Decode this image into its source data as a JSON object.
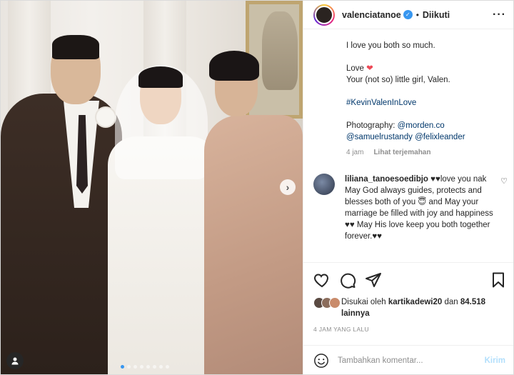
{
  "post": {
    "username": "valenciatanoe",
    "verified_icon": "verified-badge-icon",
    "separator": "•",
    "follow_status": "Diikuti",
    "more_icon": "more-options-icon"
  },
  "caption": {
    "line1": "I love you both so much.",
    "love_label": "Love",
    "love_emoji": "❤️",
    "line3": "Your (not so) little girl, Valen.",
    "hashtag": "#KevinValenInLove",
    "photo_label": "Photography:",
    "credit1": "@morden.co",
    "credit2": "@samuelrustandy",
    "credit3": "@felixleander",
    "time": "4 jam",
    "translate": "Lihat terjemahan"
  },
  "comment": {
    "username": "liliana_tanoesoedibjo",
    "text": "♥♥love you nak\nMay God always guides, protects and blesses both of you 😇 and May your marriage be filled with joy and happiness ♥♥ May His love keep you both together forever.♥♥",
    "like_icon": "heart-outline-icon"
  },
  "actions": {
    "icons": [
      "heart-icon",
      "comment-icon",
      "share-icon",
      "bookmark-icon"
    ]
  },
  "likes": {
    "prefix": "Disukai oleh",
    "user": "kartikadewi20",
    "middle": "dan",
    "count": "84.518",
    "suffix": "lainnya"
  },
  "time_ago": "4 JAM YANG LALU",
  "comment_input": {
    "placeholder": "Tambahkan komentar...",
    "post_label": "Kirim"
  },
  "carousel": {
    "next_glyph": "›",
    "dots": 8,
    "active_dot": 1
  },
  "colors": {
    "accent": "#3897f0",
    "link": "#00376b",
    "muted": "#8e8e8e",
    "post_disabled": "#b2dffc"
  }
}
